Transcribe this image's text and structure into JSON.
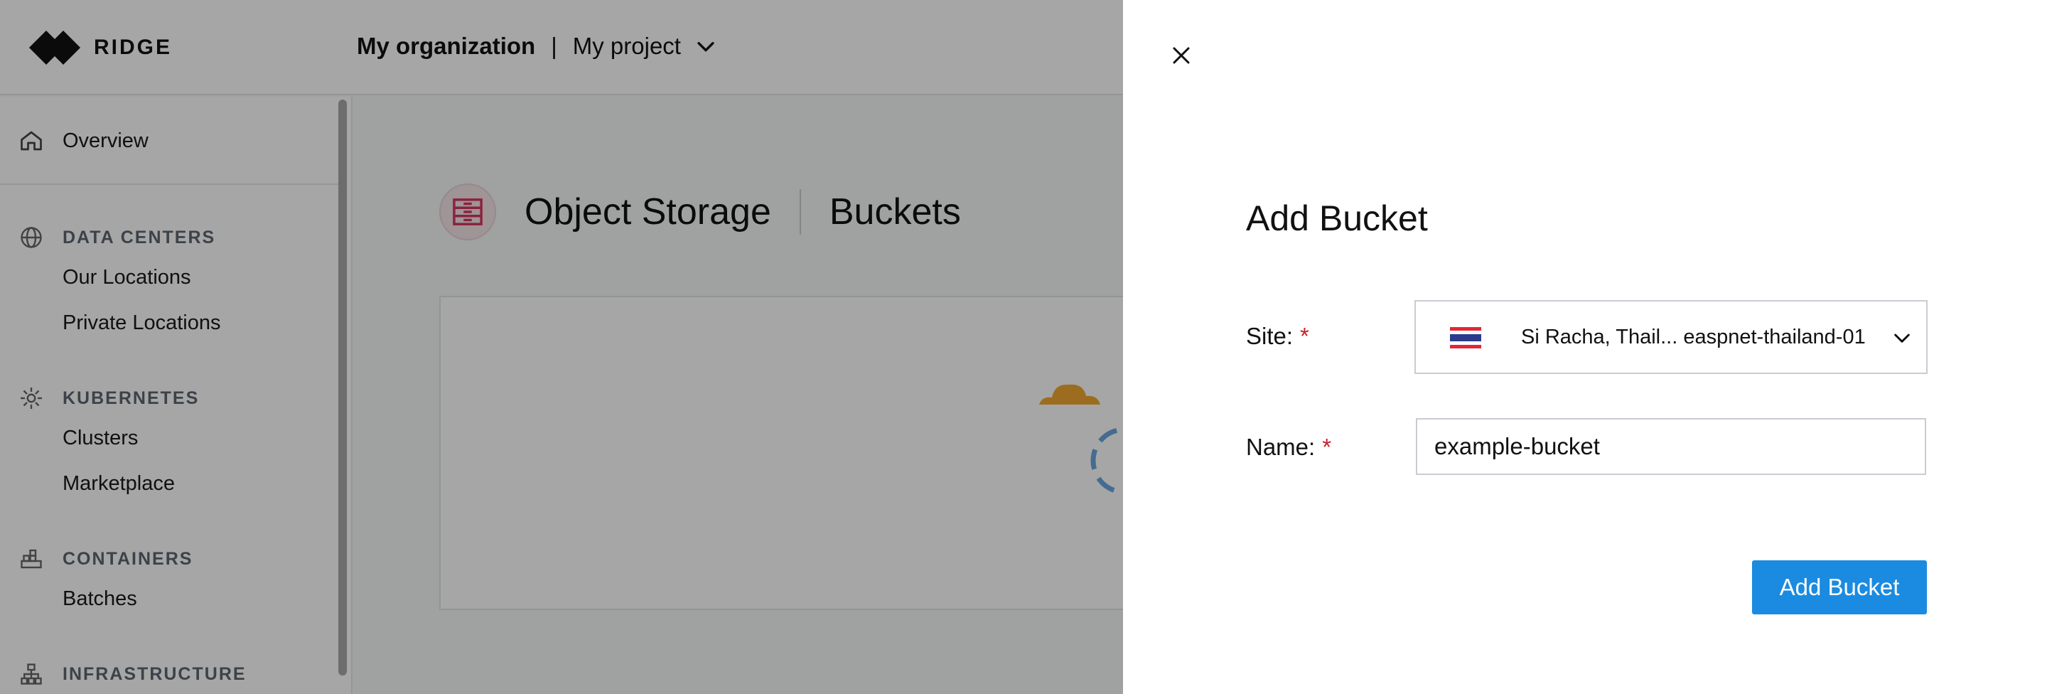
{
  "app": {
    "logo_text": "RIDGE",
    "org": "My organization",
    "org_separator": "|",
    "project": "My project"
  },
  "sidebar": {
    "overview": "Overview",
    "sections": [
      {
        "heading": "DATA CENTERS",
        "items": [
          "Our Locations",
          "Private Locations"
        ]
      },
      {
        "heading": "KUBERNETES",
        "items": [
          "Clusters",
          "Marketplace"
        ]
      },
      {
        "heading": "CONTAINERS",
        "items": [
          "Batches"
        ]
      },
      {
        "heading": "INFRASTRUCTURE",
        "items": []
      }
    ]
  },
  "main": {
    "title": "Object Storage",
    "subtitle": "Buckets"
  },
  "drawer": {
    "title": "Add Bucket",
    "site_label": "Site:",
    "site_value": "Si Racha, Thail...  easpnet-thailand-01",
    "name_label": "Name:",
    "name_value": "example-bucket",
    "required_mark": "*",
    "submit_label": "Add Bucket"
  },
  "colors": {
    "accent": "#1a8be0",
    "required": "#c6212b",
    "overlay": "rgba(0,0,0,0.35)",
    "storage_icon": "#d6355f"
  },
  "icons": [
    "close-icon",
    "chevron-down-icon",
    "home-icon",
    "globe-icon",
    "kubernetes-icon",
    "containers-icon",
    "infrastructure-icon",
    "thailand-flag-icon",
    "object-storage-icon"
  ]
}
